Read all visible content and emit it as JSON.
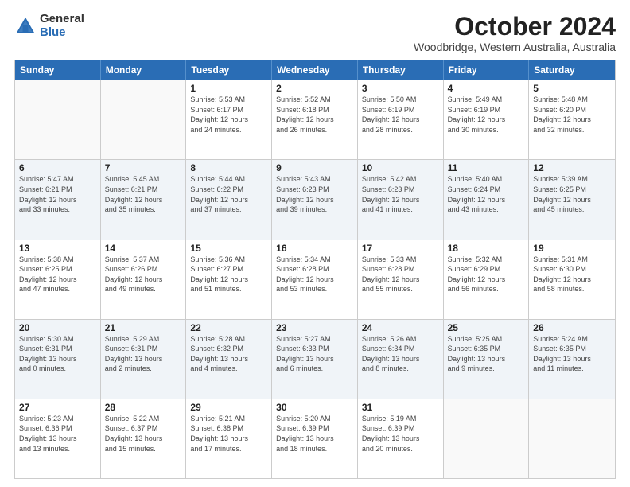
{
  "logo": {
    "line1": "General",
    "line2": "Blue"
  },
  "title": "October 2024",
  "subtitle": "Woodbridge, Western Australia, Australia",
  "weekdays": [
    "Sunday",
    "Monday",
    "Tuesday",
    "Wednesday",
    "Thursday",
    "Friday",
    "Saturday"
  ],
  "rows": [
    [
      {
        "day": "",
        "info": ""
      },
      {
        "day": "",
        "info": ""
      },
      {
        "day": "1",
        "info": "Sunrise: 5:53 AM\nSunset: 6:17 PM\nDaylight: 12 hours\nand 24 minutes."
      },
      {
        "day": "2",
        "info": "Sunrise: 5:52 AM\nSunset: 6:18 PM\nDaylight: 12 hours\nand 26 minutes."
      },
      {
        "day": "3",
        "info": "Sunrise: 5:50 AM\nSunset: 6:19 PM\nDaylight: 12 hours\nand 28 minutes."
      },
      {
        "day": "4",
        "info": "Sunrise: 5:49 AM\nSunset: 6:19 PM\nDaylight: 12 hours\nand 30 minutes."
      },
      {
        "day": "5",
        "info": "Sunrise: 5:48 AM\nSunset: 6:20 PM\nDaylight: 12 hours\nand 32 minutes."
      }
    ],
    [
      {
        "day": "6",
        "info": "Sunrise: 5:47 AM\nSunset: 6:21 PM\nDaylight: 12 hours\nand 33 minutes."
      },
      {
        "day": "7",
        "info": "Sunrise: 5:45 AM\nSunset: 6:21 PM\nDaylight: 12 hours\nand 35 minutes."
      },
      {
        "day": "8",
        "info": "Sunrise: 5:44 AM\nSunset: 6:22 PM\nDaylight: 12 hours\nand 37 minutes."
      },
      {
        "day": "9",
        "info": "Sunrise: 5:43 AM\nSunset: 6:23 PM\nDaylight: 12 hours\nand 39 minutes."
      },
      {
        "day": "10",
        "info": "Sunrise: 5:42 AM\nSunset: 6:23 PM\nDaylight: 12 hours\nand 41 minutes."
      },
      {
        "day": "11",
        "info": "Sunrise: 5:40 AM\nSunset: 6:24 PM\nDaylight: 12 hours\nand 43 minutes."
      },
      {
        "day": "12",
        "info": "Sunrise: 5:39 AM\nSunset: 6:25 PM\nDaylight: 12 hours\nand 45 minutes."
      }
    ],
    [
      {
        "day": "13",
        "info": "Sunrise: 5:38 AM\nSunset: 6:25 PM\nDaylight: 12 hours\nand 47 minutes."
      },
      {
        "day": "14",
        "info": "Sunrise: 5:37 AM\nSunset: 6:26 PM\nDaylight: 12 hours\nand 49 minutes."
      },
      {
        "day": "15",
        "info": "Sunrise: 5:36 AM\nSunset: 6:27 PM\nDaylight: 12 hours\nand 51 minutes."
      },
      {
        "day": "16",
        "info": "Sunrise: 5:34 AM\nSunset: 6:28 PM\nDaylight: 12 hours\nand 53 minutes."
      },
      {
        "day": "17",
        "info": "Sunrise: 5:33 AM\nSunset: 6:28 PM\nDaylight: 12 hours\nand 55 minutes."
      },
      {
        "day": "18",
        "info": "Sunrise: 5:32 AM\nSunset: 6:29 PM\nDaylight: 12 hours\nand 56 minutes."
      },
      {
        "day": "19",
        "info": "Sunrise: 5:31 AM\nSunset: 6:30 PM\nDaylight: 12 hours\nand 58 minutes."
      }
    ],
    [
      {
        "day": "20",
        "info": "Sunrise: 5:30 AM\nSunset: 6:31 PM\nDaylight: 13 hours\nand 0 minutes."
      },
      {
        "day": "21",
        "info": "Sunrise: 5:29 AM\nSunset: 6:31 PM\nDaylight: 13 hours\nand 2 minutes."
      },
      {
        "day": "22",
        "info": "Sunrise: 5:28 AM\nSunset: 6:32 PM\nDaylight: 13 hours\nand 4 minutes."
      },
      {
        "day": "23",
        "info": "Sunrise: 5:27 AM\nSunset: 6:33 PM\nDaylight: 13 hours\nand 6 minutes."
      },
      {
        "day": "24",
        "info": "Sunrise: 5:26 AM\nSunset: 6:34 PM\nDaylight: 13 hours\nand 8 minutes."
      },
      {
        "day": "25",
        "info": "Sunrise: 5:25 AM\nSunset: 6:35 PM\nDaylight: 13 hours\nand 9 minutes."
      },
      {
        "day": "26",
        "info": "Sunrise: 5:24 AM\nSunset: 6:35 PM\nDaylight: 13 hours\nand 11 minutes."
      }
    ],
    [
      {
        "day": "27",
        "info": "Sunrise: 5:23 AM\nSunset: 6:36 PM\nDaylight: 13 hours\nand 13 minutes."
      },
      {
        "day": "28",
        "info": "Sunrise: 5:22 AM\nSunset: 6:37 PM\nDaylight: 13 hours\nand 15 minutes."
      },
      {
        "day": "29",
        "info": "Sunrise: 5:21 AM\nSunset: 6:38 PM\nDaylight: 13 hours\nand 17 minutes."
      },
      {
        "day": "30",
        "info": "Sunrise: 5:20 AM\nSunset: 6:39 PM\nDaylight: 13 hours\nand 18 minutes."
      },
      {
        "day": "31",
        "info": "Sunrise: 5:19 AM\nSunset: 6:39 PM\nDaylight: 13 hours\nand 20 minutes."
      },
      {
        "day": "",
        "info": ""
      },
      {
        "day": "",
        "info": ""
      }
    ]
  ],
  "altRows": [
    1,
    3
  ]
}
